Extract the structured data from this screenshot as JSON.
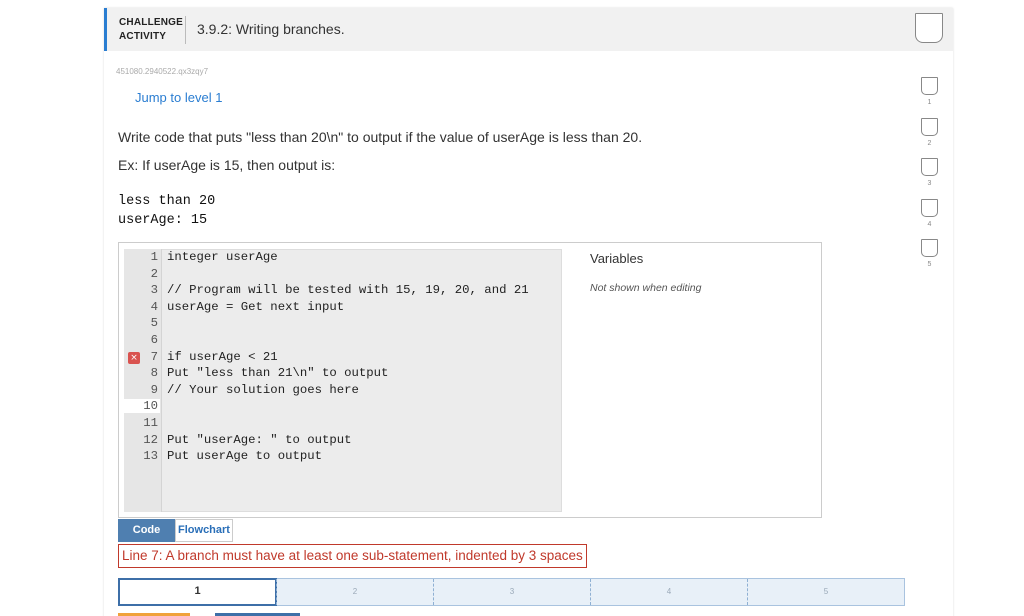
{
  "header": {
    "label_line1": "CHALLENGE",
    "label_line2": "ACTIVITY",
    "title": "3.9.2: Writing branches."
  },
  "activity_id": "451080.2940522.qx3zqy7",
  "jump_label": "Jump to level 1",
  "prompt": {
    "line1": "Write code that puts \"less than 20\\n\" to output if the value of userAge is less than 20.",
    "line2": "Ex: If userAge is 15, then output is:"
  },
  "expected_output": {
    "line1": "less than 20",
    "line2": "userAge: 15"
  },
  "code": [
    {
      "n": "1",
      "text": "integer userAge"
    },
    {
      "n": "2",
      "text": ""
    },
    {
      "n": "3",
      "text": "// Program will be tested with 15, 19, 20, and 21"
    },
    {
      "n": "4",
      "text": "userAge = Get next input"
    },
    {
      "n": "5",
      "text": ""
    },
    {
      "n": "6",
      "text": ""
    },
    {
      "n": "7",
      "text": "if userAge < 21"
    },
    {
      "n": "8",
      "text": "Put \"less than 21\\n\" to output"
    },
    {
      "n": "9",
      "text": "// Your solution goes here"
    },
    {
      "n": "10",
      "text": ""
    },
    {
      "n": "11",
      "text": ""
    },
    {
      "n": "12",
      "text": "Put \"userAge: \" to output"
    },
    {
      "n": "13",
      "text": "Put userAge to output"
    }
  ],
  "error_marker": "×",
  "variables": {
    "title": "Variables",
    "note": "Not shown when editing"
  },
  "tabs": {
    "code": "Code",
    "flowchart": "Flowchart"
  },
  "error_message": "Line 7: A branch must have at least one sub-statement, indented by 3 spaces",
  "levels": [
    "1",
    "2",
    "3",
    "4",
    "5"
  ],
  "progress": {
    "segments": [
      "1",
      "2",
      "3",
      "4",
      "5"
    ],
    "current": 1
  },
  "colors": {
    "accent": "#2a7dd1",
    "error": "#c0392b",
    "tab_active": "#4f7fb0"
  }
}
